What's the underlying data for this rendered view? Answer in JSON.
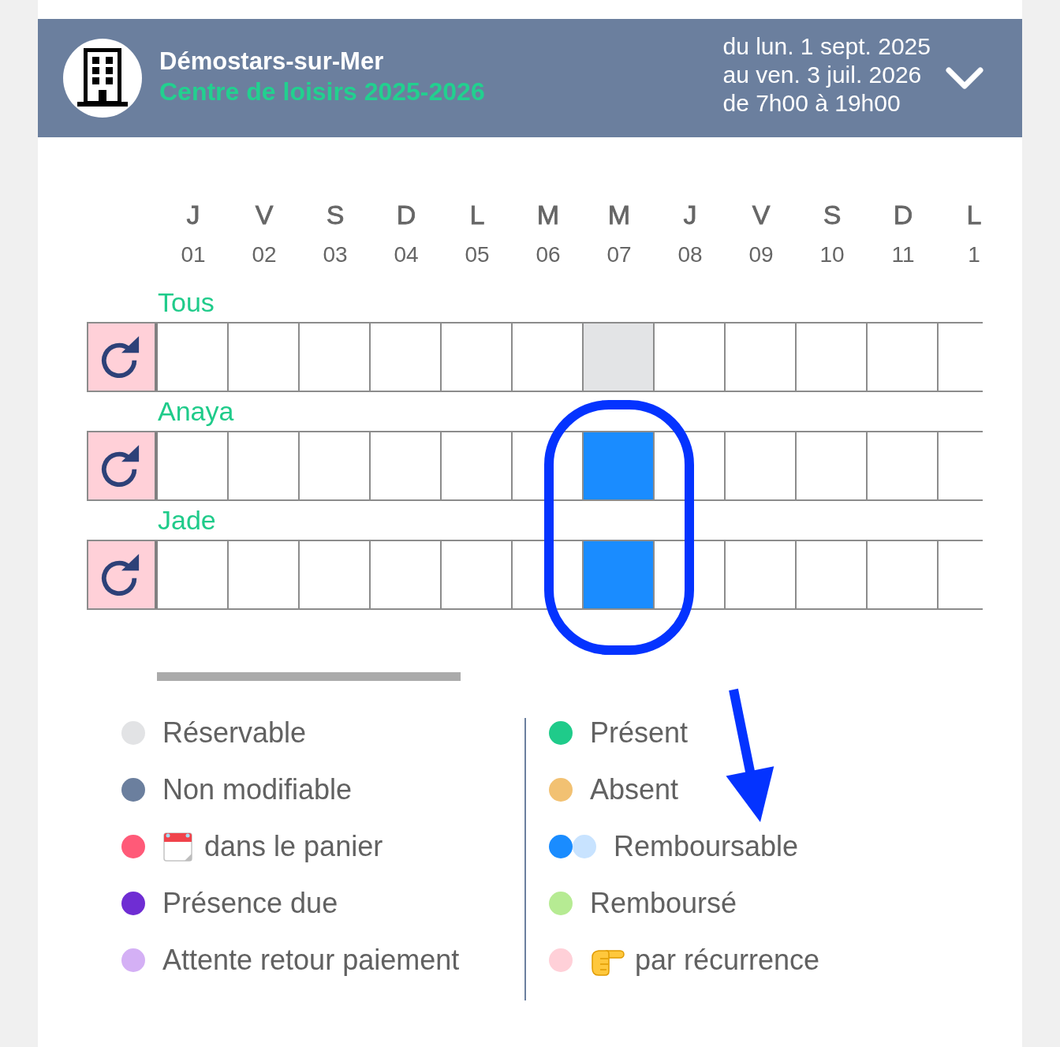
{
  "header": {
    "place": "Démostars-sur-Mer",
    "activity": "Centre de loisirs 2025-2026",
    "period": [
      "du lun. 1 sept. 2025",
      "au ven. 3 juil. 2026",
      "de 7h00 à 19h00"
    ],
    "expanded": false
  },
  "days": [
    {
      "weekday": "J",
      "date": "01"
    },
    {
      "weekday": "V",
      "date": "02"
    },
    {
      "weekday": "S",
      "date": "03"
    },
    {
      "weekday": "D",
      "date": "04"
    },
    {
      "weekday": "L",
      "date": "05"
    },
    {
      "weekday": "M",
      "date": "06"
    },
    {
      "weekday": "M",
      "date": "07"
    },
    {
      "weekday": "J",
      "date": "08"
    },
    {
      "weekday": "V",
      "date": "09"
    },
    {
      "weekday": "S",
      "date": "10"
    },
    {
      "weekday": "D",
      "date": "11"
    },
    {
      "weekday": "L",
      "date": "1"
    }
  ],
  "rows": [
    {
      "label": "Tous",
      "cells": [
        {
          "kind": "empty",
          "circled": false
        },
        {
          "kind": "empty",
          "circled": false
        },
        {
          "kind": "empty",
          "circled": false
        },
        {
          "kind": "empty",
          "circled": false
        },
        {
          "kind": "empty",
          "circled": false
        },
        {
          "kind": "empty",
          "circled": false
        },
        {
          "kind": "reservable",
          "circled": false
        },
        {
          "kind": "empty",
          "circled": false
        },
        {
          "kind": "empty",
          "circled": false
        },
        {
          "kind": "empty",
          "circled": false
        },
        {
          "kind": "empty",
          "circled": false
        }
      ]
    },
    {
      "label": "Anaya",
      "cells": [
        {
          "kind": "empty",
          "circled": false
        },
        {
          "kind": "empty",
          "circled": false
        },
        {
          "kind": "empty",
          "circled": false
        },
        {
          "kind": "empty",
          "circled": false
        },
        {
          "kind": "empty",
          "circled": false
        },
        {
          "kind": "empty",
          "circled": false
        },
        {
          "kind": "refundable",
          "circled": true
        },
        {
          "kind": "empty",
          "circled": false
        },
        {
          "kind": "empty",
          "circled": false
        },
        {
          "kind": "empty",
          "circled": false
        },
        {
          "kind": "empty",
          "circled": false
        }
      ]
    },
    {
      "label": "Jade",
      "cells": [
        {
          "kind": "empty",
          "circled": false
        },
        {
          "kind": "empty",
          "circled": false
        },
        {
          "kind": "empty",
          "circled": false
        },
        {
          "kind": "empty",
          "circled": false
        },
        {
          "kind": "empty",
          "circled": false
        },
        {
          "kind": "empty",
          "circled": false
        },
        {
          "kind": "refundable",
          "circled": true
        },
        {
          "kind": "empty",
          "circled": false
        },
        {
          "kind": "empty",
          "circled": false
        },
        {
          "kind": "empty",
          "circled": false
        },
        {
          "kind": "empty",
          "circled": false
        }
      ]
    }
  ],
  "callout_arrow": true,
  "legend": {
    "left": [
      {
        "kind": "plain",
        "dots": [
          {
            "color": "#e2e3e5"
          }
        ],
        "label": "Réservable"
      },
      {
        "kind": "plain",
        "dots": [
          {
            "color": "#6b7f9e"
          }
        ],
        "label": "Non modifiable"
      },
      {
        "kind": "calendar",
        "dots": [
          {
            "color": "#ff5a78"
          }
        ],
        "label": "dans le panier"
      },
      {
        "kind": "plain",
        "dots": [
          {
            "color": "#6f2dd3"
          }
        ],
        "label": "Présence due"
      },
      {
        "kind": "plain",
        "dots": [
          {
            "color": "#d4b0f5"
          }
        ],
        "label": "Attente retour paiement"
      }
    ],
    "right": [
      {
        "kind": "plain",
        "dots": [
          {
            "color": "#1fcb8a"
          }
        ],
        "label": "Présent"
      },
      {
        "kind": "plain",
        "dots": [
          {
            "color": "#f2c172"
          }
        ],
        "label": "Absent"
      },
      {
        "kind": "plain",
        "dots": [
          {
            "color": "#1a8cff"
          },
          {
            "color": "#c8e3ff"
          }
        ],
        "label": "Remboursable"
      },
      {
        "kind": "plain",
        "dots": [
          {
            "color": "#b6eb93"
          }
        ],
        "label": "Remboursé"
      },
      {
        "kind": "hand",
        "dots": [
          {
            "color": "#ffd0d8"
          }
        ],
        "label": "par récurrence"
      }
    ]
  }
}
